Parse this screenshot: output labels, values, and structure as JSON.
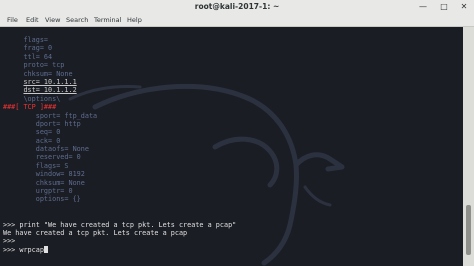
{
  "window": {
    "title": "root@kali-2017-1: ~",
    "minimize_icon": "minimize-icon",
    "maximize_icon": "maximize-icon",
    "close_icon": "close-icon"
  },
  "menu": [
    "File",
    "Edit",
    "View",
    "Search",
    "Terminal",
    "Help"
  ],
  "terminal": {
    "lines": [
      {
        "pre": "     ",
        "text": "flags=",
        "cls": "dim"
      },
      {
        "pre": "     ",
        "text": "frag= 0",
        "cls": "dim"
      },
      {
        "pre": "     ",
        "text": "ttl= 64",
        "cls": "dim"
      },
      {
        "pre": "     ",
        "text": "proto= tcp",
        "cls": "dim"
      },
      {
        "pre": "     ",
        "text": "chksum= None",
        "cls": "dim"
      },
      {
        "pre": "     ",
        "text": "src= 10.1.1.1",
        "cls": "ul"
      },
      {
        "pre": "     ",
        "text": "dst= 10.1.1.2",
        "cls": "ul"
      },
      {
        "pre": "     ",
        "text": "\\options\\",
        "cls": "dim"
      },
      {
        "pre": "",
        "text": "###[ TCP ]###",
        "cls": "red"
      },
      {
        "pre": "        ",
        "text": "sport= ftp_data",
        "cls": "dim"
      },
      {
        "pre": "        ",
        "text": "dport= http",
        "cls": "dim"
      },
      {
        "pre": "        ",
        "text": "seq= 0",
        "cls": "dim"
      },
      {
        "pre": "        ",
        "text": "ack= 0",
        "cls": "dim"
      },
      {
        "pre": "        ",
        "text": "dataofs= None",
        "cls": "dim"
      },
      {
        "pre": "        ",
        "text": "reserved= 0",
        "cls": "dim"
      },
      {
        "pre": "        ",
        "text": "flags= S",
        "cls": "dim"
      },
      {
        "pre": "        ",
        "text": "window= 8192",
        "cls": "dim"
      },
      {
        "pre": "        ",
        "text": "chksum= None",
        "cls": "dim"
      },
      {
        "pre": "        ",
        "text": "urgptr= 0",
        "cls": "dim"
      },
      {
        "pre": "        ",
        "text": "options= {}",
        "cls": "dim"
      },
      {
        "pre": "",
        "text": "",
        "cls": "dim"
      },
      {
        "pre": "",
        "text": "",
        "cls": "dim"
      },
      {
        "pre": "",
        "text": ">>> print \"We have created a tcp pkt. Lets create a pcap\"",
        "cls": "white"
      },
      {
        "pre": "",
        "text": "We have created a tcp pkt. Lets create a pcap",
        "cls": "white"
      },
      {
        "pre": "",
        "text": ">>>",
        "cls": "white"
      },
      {
        "pre": "",
        "text": ">>> wrpcap",
        "cls": "white"
      }
    ]
  },
  "colors": {
    "terminal_bg": "#1b1d24",
    "prompt_text": "#e0e0e0",
    "field_text": "#5e6d8f",
    "header_red": "#ee3333"
  }
}
